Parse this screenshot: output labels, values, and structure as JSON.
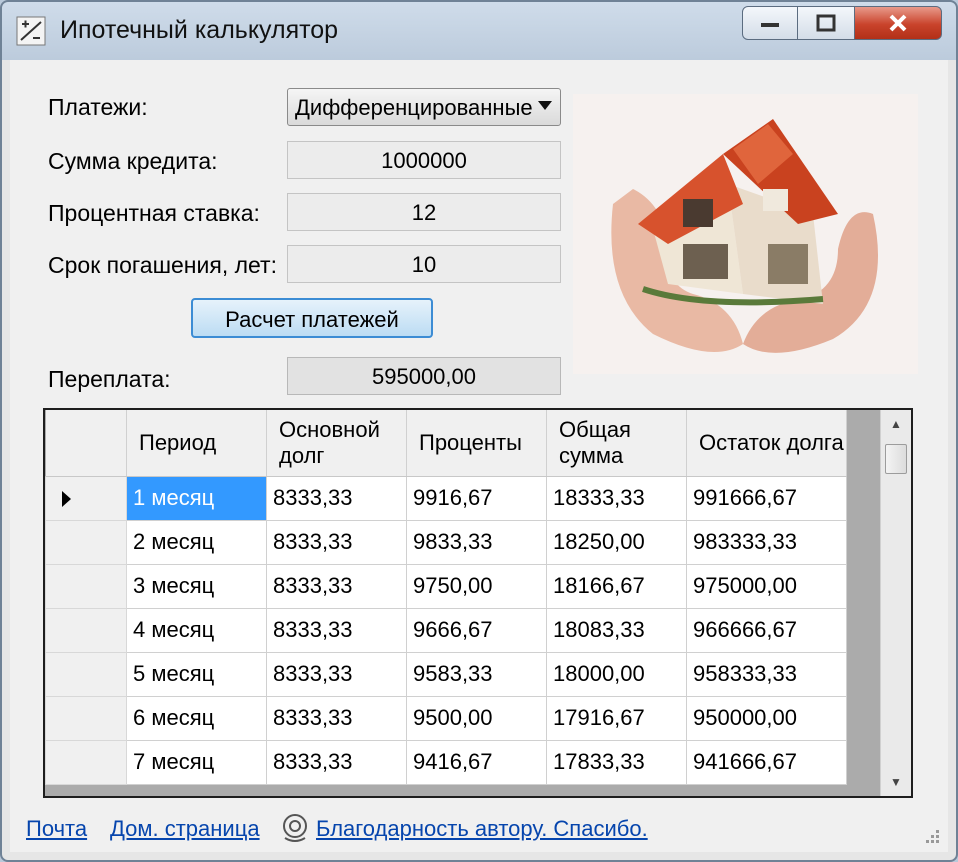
{
  "window": {
    "title": "Ипотечный калькулятор",
    "minimize_icon": "minimize-icon",
    "maximize_icon": "maximize-icon",
    "close_icon": "close-icon"
  },
  "form": {
    "payments_label": "Платежи:",
    "payments_value": "Дифференцированные",
    "loan_amount_label": "Сумма кредита:",
    "loan_amount_value": "1000000",
    "interest_rate_label": "Процентная ставка:",
    "interest_rate_value": "12",
    "term_label": "Срок погашения, лет:",
    "term_value": "10",
    "calc_button": "Расчет платежей",
    "overpayment_label": "Переплата:",
    "overpayment_value": "595000,00"
  },
  "table": {
    "headers": [
      "Период",
      "Основной долг",
      "Проценты",
      "Общая сумма",
      "Остаток долга"
    ],
    "rows": [
      [
        "1 месяц",
        "8333,33",
        "9916,67",
        "18333,33",
        "991666,67"
      ],
      [
        "2 месяц",
        "8333,33",
        "9833,33",
        "18250,00",
        "983333,33"
      ],
      [
        "3 месяц",
        "8333,33",
        "9750,00",
        "18166,67",
        "975000,00"
      ],
      [
        "4 месяц",
        "8333,33",
        "9666,67",
        "18083,33",
        "966666,67"
      ],
      [
        "5 месяц",
        "8333,33",
        "9583,33",
        "18000,00",
        "958333,33"
      ],
      [
        "6 месяц",
        "8333,33",
        "9500,00",
        "17916,67",
        "950000,00"
      ],
      [
        "7 месяц",
        "8333,33",
        "9416,67",
        "17833,33",
        "941666,67"
      ]
    ]
  },
  "status": {
    "mail_link": "Почта",
    "home_link": "Дом. страница",
    "thanks_link": "Благодарность автору. Спасибо."
  },
  "colors": {
    "selection": "#3399ff",
    "link": "#0645ad",
    "button_border": "#3c8cd4"
  }
}
